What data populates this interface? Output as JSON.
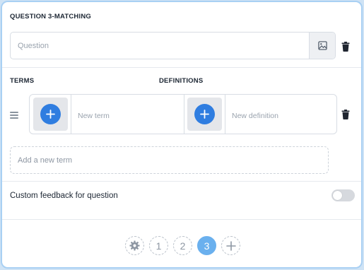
{
  "question": {
    "title": "QUESTION 3-MATCHING",
    "placeholder": "Question",
    "image_icon": "image-icon",
    "delete_icon": "trash-icon"
  },
  "columns": {
    "terms": "TERMS",
    "definitions": "DEFINITIONS"
  },
  "pairs": [
    {
      "term_placeholder": "New term",
      "definition_placeholder": "New definition"
    }
  ],
  "add_term": {
    "placeholder": "Add a new term"
  },
  "feedback": {
    "label": "Custom feedback for question",
    "enabled": false
  },
  "pager": {
    "settings_icon": "gear-icon",
    "pages": [
      "1",
      "2",
      "3"
    ],
    "active_page": "3",
    "add_icon": "plus-icon"
  },
  "colors": {
    "accent": "#2f7de0",
    "active_page": "#6ab0ee",
    "card_border": "#a9d0f3"
  }
}
